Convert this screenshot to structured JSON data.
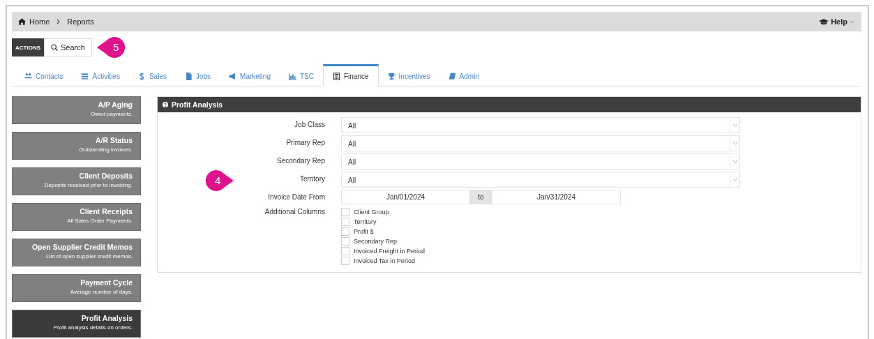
{
  "breadcrumb": [
    "Home",
    "Reports"
  ],
  "help": {
    "label": "Help"
  },
  "actions": {
    "label": "ACTIONS",
    "search": "Search",
    "callout": "5"
  },
  "tabs": [
    {
      "label": "Contacts",
      "selected": false
    },
    {
      "label": "Activities",
      "selected": false
    },
    {
      "label": "Sales",
      "selected": false
    },
    {
      "label": "Jobs",
      "selected": false
    },
    {
      "label": "Marketing",
      "selected": false
    },
    {
      "label": "TSC",
      "selected": false
    },
    {
      "label": "Finance",
      "selected": true
    },
    {
      "label": "Incentives",
      "selected": false
    },
    {
      "label": "Admin",
      "selected": false
    }
  ],
  "sidebar": {
    "items": [
      {
        "title": "A/P Aging",
        "subtitle": "Owed payments.",
        "selected": false
      },
      {
        "title": "A/R Status",
        "subtitle": "Outstanding invoices.",
        "selected": false
      },
      {
        "title": "Client Deposits",
        "subtitle": "Deposits received prior to invoicing.",
        "selected": false
      },
      {
        "title": "Client Receipts",
        "subtitle": "All Sales Order Payments.",
        "selected": false
      },
      {
        "title": "Open Supplier Credit Memos",
        "subtitle": "List of open supplier credit memos.",
        "selected": false
      },
      {
        "title": "Payment Cycle",
        "subtitle": "Average number of days.",
        "selected": false
      },
      {
        "title": "Profit Analysis",
        "subtitle": "Profit analysis details on orders.",
        "selected": true
      }
    ]
  },
  "panel": {
    "title": "Profit Analysis",
    "callout": "4",
    "selects": [
      {
        "label": "Job Class",
        "value": "All"
      },
      {
        "label": "Primary Rep",
        "value": "All"
      },
      {
        "label": "Secondary Rep",
        "value": "All"
      },
      {
        "label": "Territory",
        "value": "All"
      }
    ],
    "date_range": {
      "label": "Invoice Date From",
      "from": "Jan/01/2024",
      "separator": "to",
      "to": "Jan/31/2024"
    },
    "additional_columns": {
      "label": "Additional Columns",
      "options": [
        {
          "label": "Client Group",
          "checked": false
        },
        {
          "label": "Territory",
          "checked": false
        },
        {
          "label": "Profit $",
          "checked": false
        },
        {
          "label": "Secondary Rep",
          "checked": false
        },
        {
          "label": "Invoiced Freight in Period",
          "checked": false
        },
        {
          "label": "Invoiced Tax in Period",
          "checked": false
        }
      ]
    }
  }
}
